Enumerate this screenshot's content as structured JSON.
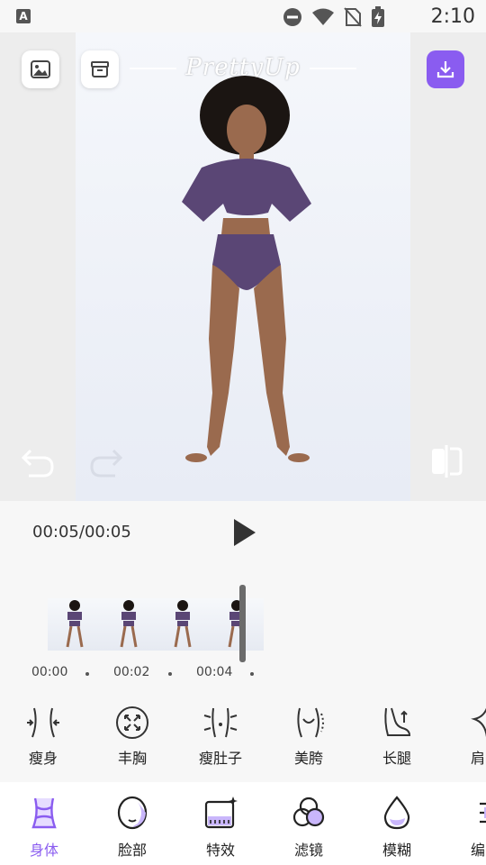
{
  "status_bar": {
    "time": "2:10",
    "app_glyph": "A"
  },
  "preview": {
    "brand": "PrettyUp",
    "icons": {
      "gallery": "image-icon",
      "archive": "archive-icon",
      "download": "download-icon",
      "undo": "undo-icon",
      "redo": "redo-icon",
      "compare": "compare-icon"
    }
  },
  "player": {
    "timer": "00:05/00:05",
    "ticks": [
      "00:00",
      "00:02",
      "00:04"
    ]
  },
  "tools": [
    {
      "label": "瘦身",
      "icon": "waist-slim-icon"
    },
    {
      "label": "丰胸",
      "icon": "enlarge-icon"
    },
    {
      "label": "瘦肚子",
      "icon": "belly-slim-icon"
    },
    {
      "label": "美胯",
      "icon": "hip-icon"
    },
    {
      "label": "长腿",
      "icon": "long-legs-icon"
    },
    {
      "label": "肩",
      "icon": "shoulder-icon"
    }
  ],
  "nav": [
    {
      "label": "身体",
      "icon": "body-icon",
      "active": true
    },
    {
      "label": "脸部",
      "icon": "face-icon"
    },
    {
      "label": "特效",
      "icon": "effects-icon"
    },
    {
      "label": "滤镜",
      "icon": "filters-icon"
    },
    {
      "label": "模糊",
      "icon": "blur-icon"
    },
    {
      "label": "编",
      "icon": "edit-icon"
    }
  ],
  "colors": {
    "accent": "#8a5cf0",
    "outfit": "#5a4675",
    "skin": "#9a6a4e",
    "hair": "#1b1512"
  }
}
